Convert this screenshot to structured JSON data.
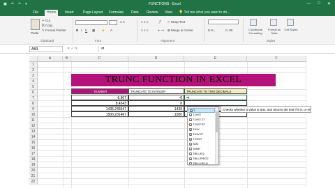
{
  "titlebar": {
    "title": "FUNCTIONS - Excel",
    "min": "—",
    "max": "□",
    "close": "✕"
  },
  "tabs": {
    "file": "File",
    "home": "Home",
    "insert": "Insert",
    "page_layout": "Page Layout",
    "formulas": "Formulas",
    "data": "Data",
    "review": "Review",
    "view": "View",
    "tell_me": "Tell me what you want to do..."
  },
  "ribbon": {
    "cut": "Cut",
    "copy": "Copy",
    "format_painter": "Format Painter",
    "paste": "Paste",
    "clipboard": "Clipboard",
    "font": "Font",
    "alignment": "Alignment",
    "wrap_text": "Wrap Text",
    "merge_center": "Merge & Center",
    "conditional_formatting": "Conditional Formatting",
    "format_as_table": "Format as Table",
    "cell_styles": "Cell Styles",
    "styles": "Styles"
  },
  "formula_bar": {
    "name_box": "AB3",
    "fx": "✕ ✓ fx",
    "content": "=t"
  },
  "columns": [
    "A",
    "B",
    "C",
    "D",
    "E",
    "F"
  ],
  "rows": [
    "1",
    "2",
    "3",
    "4",
    "5",
    "6",
    "7",
    "8",
    "9",
    "10",
    "11",
    "12",
    "13",
    "14",
    "15",
    "16",
    "17",
    "18",
    "19",
    "20",
    "21",
    "22"
  ],
  "sheet": {
    "banner": "TRUNC FUNCTION IN EXCEL",
    "header_c": "NUMBER",
    "header_d": "TRUNCATE TO INTEGER",
    "header_e": "TRUNCATE TO TWO DECIMALS",
    "c7": "-6.907",
    "d7": "-6",
    "e7": "=t",
    "c8": "8.4543",
    "d8": "8",
    "c9": "1435.245547",
    "d9": "1435",
    "c10": "1500.231467",
    "d10": "1500"
  },
  "autocomplete": {
    "items": [
      "T",
      "T.DIST",
      "T.DIST.2T",
      "T.DIST.RT",
      "T.INV",
      "T.INV.2T",
      "T.TEST",
      "TAN",
      "TANH",
      "TBILLEQ",
      "TBILLPRICE",
      "TBILLYIELD"
    ],
    "icon": "fx",
    "tooltip": "Checks whether a value is text, and returns the text if it is, or returns double quotes (empty text) if it is not"
  }
}
